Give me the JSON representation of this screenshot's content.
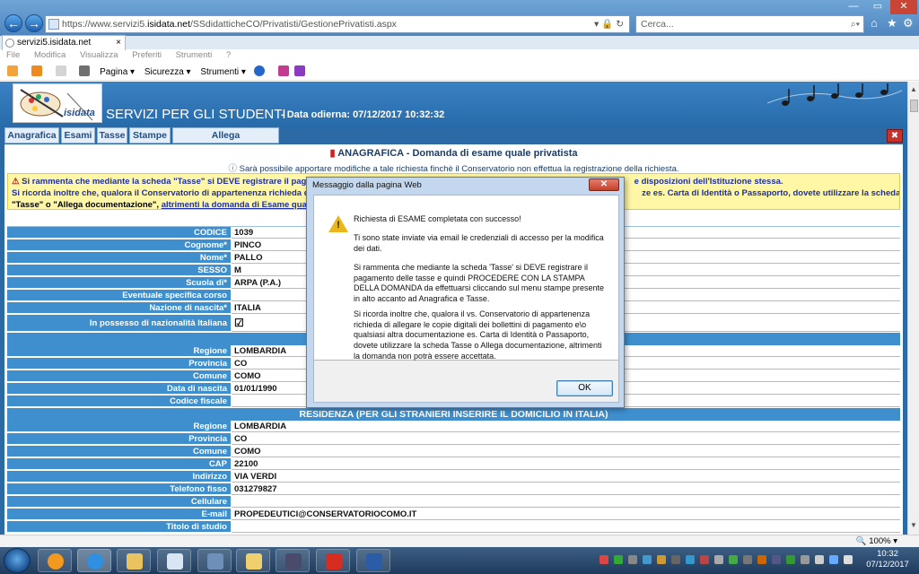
{
  "browser": {
    "url_prefix": "https://www.servizi5.",
    "url_domain": "isidata.net",
    "url_path": "/SSdidatticheCO/Privatisti/GestionePrivatisti.aspx",
    "search_placeholder": "Cerca...",
    "tab_title": "servizi5.isidata.net",
    "tab_close": "×",
    "back_glyph": "←",
    "forward_glyph": "→",
    "menu": [
      "File",
      "Modifica",
      "Visualizza",
      "Preferiti",
      "Strumenti",
      "?"
    ],
    "commands": {
      "page": "Pagina ▾",
      "safety": "Sicurezza ▾",
      "tools": "Strumenti ▾"
    },
    "zoom": "100%",
    "window_buttons": {
      "min": "—",
      "max": "▭",
      "close": "✕"
    }
  },
  "site": {
    "logo_text": "isidata",
    "title": "SERVIZI PER GLI STUDENTI",
    "date_text": "- Data odierna: 07/12/2017 10:32:32",
    "tabs": [
      "Anagrafica",
      "Esami",
      "Tasse",
      "Stampe",
      "Allega documentazione"
    ],
    "close_glyph": "✖"
  },
  "content": {
    "heading": "ANAGRAFICA - Domanda di esame quale privatista",
    "subheading": "Sarà possibile apportare modifiche a tale richiesta finchè il Conservatorio non effettua la registrazione della richiesta.",
    "warning_line1_a": "Si rammenta che mediante la scheda \"Tasse\" si DEVE registrare il paga",
    "warning_line1_b": "e disposizioni dell'Istituzione stessa.",
    "warning_line2_a": "Si ricorda inoltre che, qualora il Conservatorio di appartenenza richieda di a",
    "warning_line2_b": "ze es. Carta di Identità o Passaporto, dovete utilizzare la scheda",
    "warning_line3_a": "\"Tasse\" o \"Allega documentazione\", ",
    "warning_line3_b": "altrimenti la domanda di Esame quale",
    "fields": [
      {
        "label": "CODICE",
        "value": "1039"
      },
      {
        "label": "Cognome*",
        "value": "PINCO"
      },
      {
        "label": "Nome*",
        "value": "PALLO"
      },
      {
        "label": "SESSO",
        "value": "M"
      },
      {
        "label": "Scuola di*",
        "value": "ARPA (P.A.)"
      },
      {
        "label": "Eventuale specifica corso",
        "value": ""
      },
      {
        "label": "Nazione di nascita*",
        "value": "ITALIA"
      },
      {
        "label": "In possesso di nazionalità Italiana",
        "value": "☑"
      }
    ],
    "birth_fields": [
      {
        "label": "Regione",
        "value": "LOMBARDIA"
      },
      {
        "label": "Provincia",
        "value": "CO"
      },
      {
        "label": "Comune",
        "value": "COMO"
      },
      {
        "label": "Data di nascita",
        "value": "01/01/1990"
      },
      {
        "label": "Codice fiscale",
        "value": ""
      }
    ],
    "residence_title": "RESIDENZA (PER GLI STRANIERI INSERIRE IL DOMICILIO IN ITALIA)",
    "residence_fields": [
      {
        "label": "Regione",
        "value": "LOMBARDIA"
      },
      {
        "label": "Provincia",
        "value": "CO"
      },
      {
        "label": "Comune",
        "value": "COMO"
      },
      {
        "label": "CAP",
        "value": "22100"
      },
      {
        "label": "Indirizzo",
        "value": "VIA VERDI"
      },
      {
        "label": "Telefono fisso",
        "value": "031279827"
      },
      {
        "label": "Cellulare",
        "value": ""
      },
      {
        "label": "E-mail",
        "value": "PROPEDEUTICI@CONSERVATORIOCOMO.IT"
      },
      {
        "label": "Titolo di studio",
        "value": ""
      }
    ]
  },
  "dialog": {
    "title": "Messaggio dalla pagina Web",
    "close_glyph": "✕",
    "warning_mark": "!",
    "msg1": "Richiesta di ESAME completata con successo!",
    "msg2": "Ti sono state inviate via email le credenziali di accesso per la modifica dei dati.",
    "msg3": "Si rammenta che mediante la scheda 'Tasse' si DEVE registrare il pagamento delle tasse  e quindi PROCEDERE CON LA STAMPA DELLA DOMANDA da effettuarsi cliccando sul menu stampe presente in alto accanto ad Anagrafica e Tasse.",
    "msg4": "Si ricorda inoltre che, qualora il vs. Conservatorio di appartenenza richieda di allegare le copie digitali dei bollettini di pagamento e\\o qualsiasi altra documentazione es. Carta di Identità o Passaporto, dovete utilizzare la scheda Tasse o Allega documentazione, altrimenti la domanda non potrà essere accettata.",
    "ok_label": "OK"
  },
  "taskbar": {
    "time": "10:32",
    "date": "07/12/2017"
  }
}
